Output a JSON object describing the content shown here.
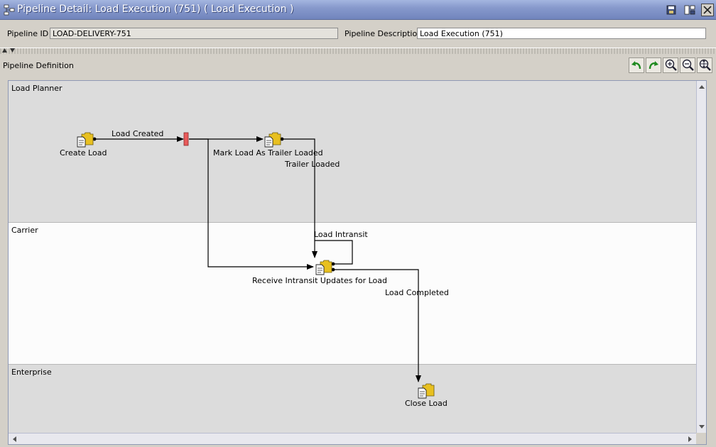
{
  "window": {
    "title": "Pipeline Detail: Load Execution (751) ( Load Execution )",
    "icons": [
      "pipeline-icon",
      "save-icon",
      "switch-view-icon",
      "close-icon"
    ]
  },
  "header": {
    "pipeline_id_label": "Pipeline ID",
    "pipeline_id_value": "LOAD-DELIVERY-751",
    "pipeline_desc_label": "Pipeline Description",
    "pipeline_desc_value": "Load Execution (751)"
  },
  "definition": {
    "section_title": "Pipeline Definition",
    "toolbar": [
      "undo-icon",
      "redo-icon",
      "zoom-in-icon",
      "zoom-out-icon",
      "zoom-fit-icon"
    ]
  },
  "lanes": [
    "Load Planner",
    "Carrier",
    "Enterprise"
  ],
  "nodes": {
    "create_load": "Create Load",
    "mark_load": "Mark Load As Trailer Loaded",
    "receive_intransit": "Receive Intransit Updates for Load",
    "close_load": "Close Load"
  },
  "edges": {
    "load_created": "Load Created",
    "trailer_loaded": "Trailer Loaded",
    "load_intransit": "Load Intransit",
    "load_completed": "Load Completed"
  },
  "colors": {
    "title_bar": "#7c8ec6",
    "node_folder": "#e8c020",
    "gate": "#e85a5a",
    "lane_alt": "#fcfcfc"
  }
}
